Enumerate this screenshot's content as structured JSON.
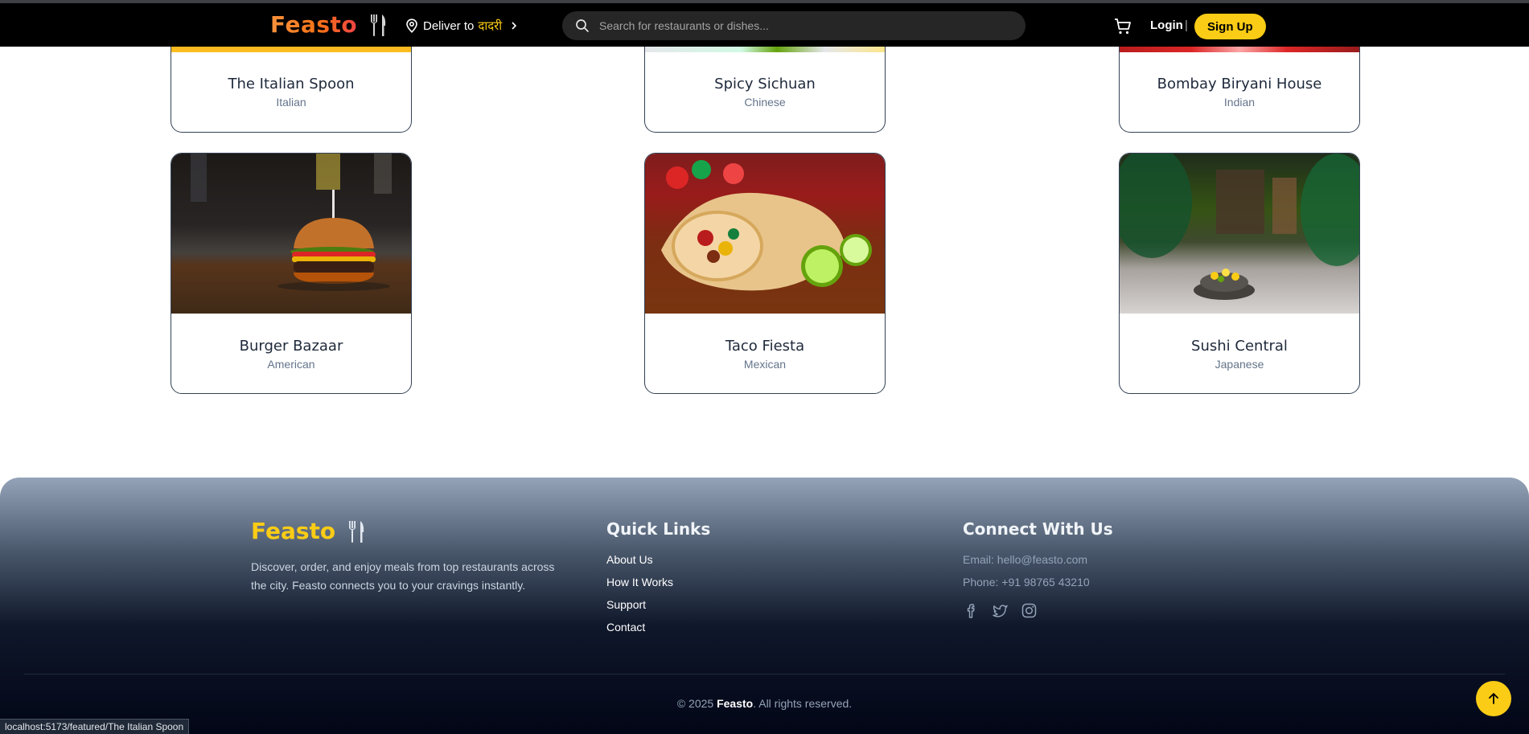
{
  "header": {
    "logo": "Feasto",
    "deliver_prefix": "Deliver to",
    "deliver_location": "दादरी",
    "search_placeholder": "Search for restaurants or dishes...",
    "login_label": "Login",
    "separator": "|",
    "signup_label": "Sign Up"
  },
  "restaurants": [
    {
      "name": "The Italian Spoon",
      "cuisine": "Italian"
    },
    {
      "name": "Spicy Sichuan",
      "cuisine": "Chinese"
    },
    {
      "name": "Bombay Biryani House",
      "cuisine": "Indian"
    },
    {
      "name": "Burger Bazaar",
      "cuisine": "American"
    },
    {
      "name": "Taco Fiesta",
      "cuisine": "Mexican"
    },
    {
      "name": "Sushi Central",
      "cuisine": "Japanese"
    }
  ],
  "footer": {
    "logo": "Feasto",
    "description": "Discover, order, and enjoy meals from top restaurants across the city. Feasto connects you to your cravings instantly.",
    "quick_links_heading": "Quick Links",
    "quick_links": [
      "About Us",
      "How It Works",
      "Support",
      "Contact"
    ],
    "connect_heading": "Connect With Us",
    "email": "Email: hello@feasto.com",
    "phone": "Phone: +91 98765 43210",
    "copyright_prefix": "© 2025",
    "copyright_brand": "Feasto",
    "copyright_suffix": ". All rights reserved."
  },
  "status_url": "localhost:5173/featured/The Italian Spoon",
  "colors": {
    "accent": "#facc15",
    "logo_gradient_start": "#fb923c",
    "logo_gradient_end": "#ef4444",
    "header_bg": "#000000",
    "footer_dark": "#020617"
  },
  "icons": [
    "cutlery-icon",
    "map-pin-icon",
    "chevron-right-icon",
    "search-icon",
    "cart-icon",
    "facebook-icon",
    "twitter-icon",
    "instagram-icon",
    "arrow-up-icon"
  ]
}
